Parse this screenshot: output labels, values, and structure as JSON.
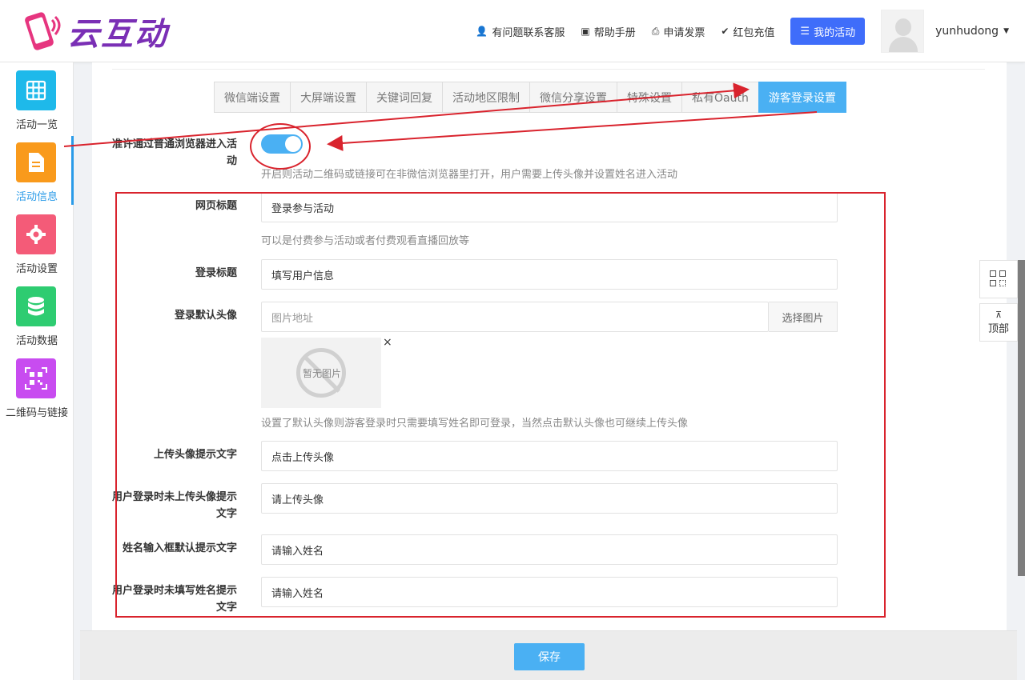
{
  "brand": {
    "name": "云互动"
  },
  "topnav": {
    "support": "有问题联系客服",
    "manual": "帮助手册",
    "invoice": "申请发票",
    "recharge": "红包充值",
    "my_activity": "我的活动",
    "username": "yunhudong"
  },
  "sidebar": {
    "items": [
      {
        "label": "活动一览",
        "color": "#1eb9ea",
        "icon": "grid-icon"
      },
      {
        "label": "活动信息",
        "color": "#f99a1c",
        "icon": "document-icon"
      },
      {
        "label": "活动设置",
        "color": "#f45b78",
        "icon": "gear-icon"
      },
      {
        "label": "活动数据",
        "color": "#2ecc71",
        "icon": "database-icon"
      },
      {
        "label": "二维码与链接",
        "color": "#c84cf0",
        "icon": "qrcode-icon"
      }
    ]
  },
  "tabs": [
    {
      "label": "微信端设置"
    },
    {
      "label": "大屏端设置"
    },
    {
      "label": "关键词回复"
    },
    {
      "label": "活动地区限制"
    },
    {
      "label": "微信分享设置"
    },
    {
      "label": "特殊设置"
    },
    {
      "label": "私有Oauth"
    },
    {
      "label": "游客登录设置"
    }
  ],
  "active_tab": "游客登录设置",
  "form": {
    "allow_browser": {
      "label": "准许通过普通浏览器进入活动",
      "enabled": true,
      "hint": "开启则活动二维码或链接可在非微信浏览器里打开，用户需要上传头像并设置姓名进入活动"
    },
    "page_title": {
      "label": "网页标题",
      "value": "登录参与活动",
      "hint": "可以是付费参与活动或者付费观看直播回放等"
    },
    "login_title": {
      "label": "登录标题",
      "value": "填写用户信息"
    },
    "default_avatar": {
      "label": "登录默认头像",
      "placeholder": "图片地址",
      "pick_label": "选择图片",
      "no_image_text": "暂无图片",
      "close": "×",
      "hint": "设置了默认头像则游客登录时只需要填写姓名即可登录，当然点击默认头像也可继续上传头像"
    },
    "upload_hint_text": {
      "label": "上传头像提示文字",
      "value": "点击上传头像"
    },
    "no_avatar_hint": {
      "label": "用户登录时未上传头像提示文字",
      "value": "请上传头像"
    },
    "name_placeholder": {
      "label": "姓名输入框默认提示文字",
      "value": "请输入姓名"
    },
    "no_name_hint": {
      "label": "用户登录时未填写姓名提示文字",
      "value": "请输入姓名"
    }
  },
  "footer": {
    "save": "保存"
  },
  "float": {
    "top": "顶部"
  },
  "colors": {
    "accent": "#4ab0f3",
    "annotation": "#d9232d",
    "primary_button": "#3f6dfa"
  }
}
